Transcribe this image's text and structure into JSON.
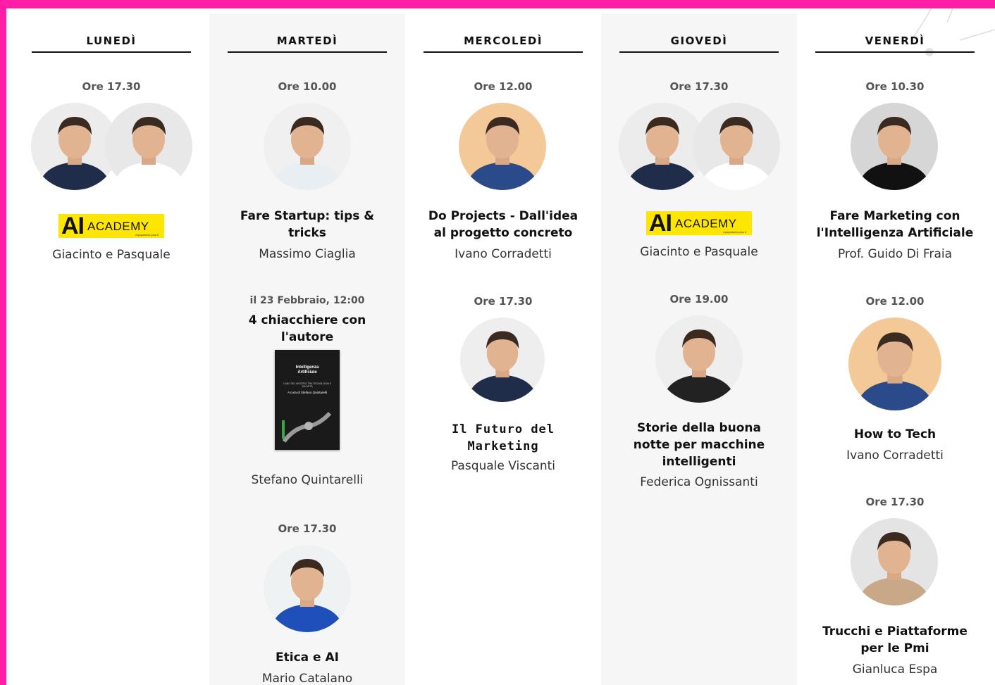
{
  "colors": {
    "frame": "#ff1ea5",
    "column_alt": "#f6f6f6",
    "logo_yellow": "#ffe600"
  },
  "days": [
    {
      "name": "LUNEDÌ",
      "events": [
        {
          "time": "Ore 17.30",
          "logo": {
            "ai": "AI",
            "academy": "ACADEMY",
            "sub": "mysyadvers.plus.it"
          },
          "speaker": "Giacinto e Pasquale"
        }
      ]
    },
    {
      "name": "MARTEDÌ",
      "events": [
        {
          "time": "Ore 10.00",
          "title_line1": "Fare Startup: tips &",
          "title_line2": "tricks",
          "speaker": "Massimo Ciaglia"
        },
        {
          "time": "il 23 Febbraio, 12:00",
          "title_line1": "4 chiacchiere con",
          "title_line2": "l'autore",
          "book": {
            "title_line1": "Intelligenza",
            "title_line2": "Artificiale",
            "subtitle": "L'ABC DEL MOSTRO TRA TECNOLOGIA E SOCIETÀ",
            "author": "A cura di Stefano Quintarelli"
          },
          "speaker": "Stefano Quintarelli"
        },
        {
          "time": "Ore 17.30",
          "title": "Etica e AI",
          "speaker": "Mario Catalano"
        }
      ]
    },
    {
      "name": "MERCOLEDÌ",
      "events": [
        {
          "time": "Ore 12.00",
          "title_line1": "Do Projects - Dall'idea",
          "title_line2": "al progetto concreto",
          "speaker": "Ivano Corradetti"
        },
        {
          "time": "Ore 17.30",
          "title_line1": "Il Futuro del",
          "title_line2": "Marketing",
          "speaker": "Pasquale Viscanti"
        }
      ]
    },
    {
      "name": "GIOVEDÌ",
      "events": [
        {
          "time": "Ore 17.30",
          "logo": {
            "ai": "AI",
            "academy": "ACADEMY",
            "sub": "mysyadvers.plus.it"
          },
          "speaker": "Giacinto e Pasquale"
        },
        {
          "time": "Ore 19.00",
          "title_line1": "Storie della buona",
          "title_line2": "notte per macchine",
          "title_line3": "intelligenti",
          "speaker": "Federica Ognissanti"
        }
      ]
    },
    {
      "name": "VENERDÌ",
      "events": [
        {
          "time": "Ore 10.30",
          "title_line1": "Fare Marketing con",
          "title_line2": "l'Intelligenza Artificiale",
          "speaker": "Prof. Guido Di Fraia"
        },
        {
          "time": "Ore 12.00",
          "title": "How to Tech",
          "speaker": "Ivano Corradetti"
        },
        {
          "time": "Ore 17.30",
          "title_line1": "Trucchi e Piattaforme",
          "title_line2": "per le Pmi",
          "speaker": "Gianluca Espa"
        }
      ]
    }
  ]
}
